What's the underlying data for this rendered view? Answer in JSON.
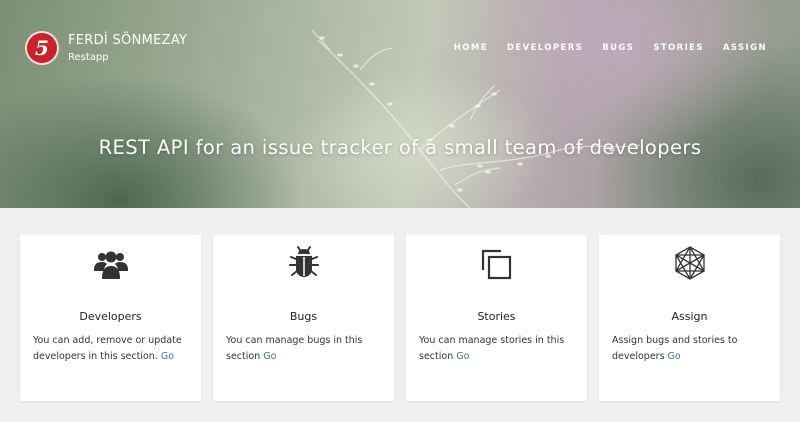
{
  "brand": {
    "logo_glyph": "5",
    "name": "FERDİ SÖNMEZAY",
    "subtitle": "Restapp",
    "logo_color": "#c9242b"
  },
  "nav": {
    "items": [
      {
        "label": "HOME"
      },
      {
        "label": "DEVELOPERS"
      },
      {
        "label": "BUGS"
      },
      {
        "label": "STORIES"
      },
      {
        "label": "ASSIGN"
      }
    ]
  },
  "hero": {
    "title": "REST API for an issue tracker of a small team of developers"
  },
  "cards": [
    {
      "icon": "users-icon",
      "title": "Developers",
      "description": "You can add, remove or update developers in this section. ",
      "link": "Go"
    },
    {
      "icon": "bug-icon",
      "title": "Bugs",
      "description": "You can manage bugs in this section ",
      "link": "Go"
    },
    {
      "icon": "copy-icon",
      "title": "Stories",
      "description": "You can manage stories in this section ",
      "link": "Go"
    },
    {
      "icon": "hexagon-icon",
      "title": "Assign",
      "description": "Assign bugs and stories to developers ",
      "link": "Go"
    }
  ],
  "colors": {
    "link": "#3a6fa8",
    "page_background": "#eef0f2",
    "icon": "#333333"
  }
}
